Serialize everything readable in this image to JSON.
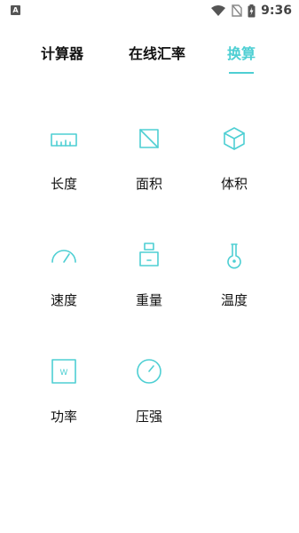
{
  "status_bar": {
    "left_icon": "A",
    "time": "9:36",
    "icons": [
      "wifi-icon",
      "no-sim-icon",
      "battery-charging-icon"
    ]
  },
  "tabs": [
    {
      "label": "计算器",
      "active": false
    },
    {
      "label": "在线汇率",
      "active": false
    },
    {
      "label": "换算",
      "active": true
    }
  ],
  "accent_color": "#4ecfd3",
  "converters": [
    {
      "label": "长度",
      "icon": "ruler-icon"
    },
    {
      "label": "面积",
      "icon": "area-icon"
    },
    {
      "label": "体积",
      "icon": "cube-icon"
    },
    {
      "label": "速度",
      "icon": "speedometer-icon"
    },
    {
      "label": "重量",
      "icon": "weight-icon"
    },
    {
      "label": "温度",
      "icon": "thermometer-icon"
    },
    {
      "label": "功率",
      "icon": "power-icon",
      "icon_text": "W"
    },
    {
      "label": "压强",
      "icon": "pressure-gauge-icon"
    }
  ]
}
